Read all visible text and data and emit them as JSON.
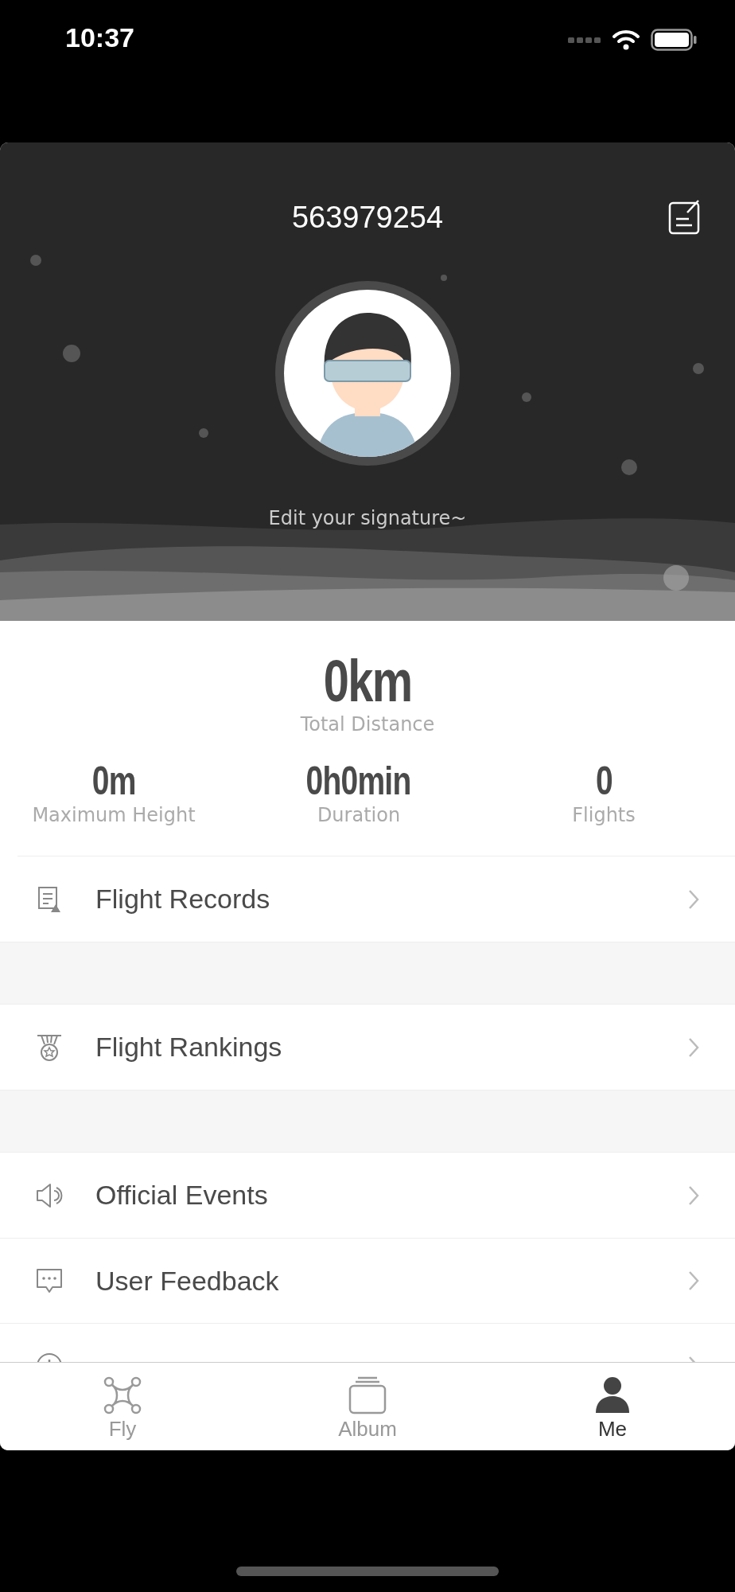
{
  "status_bar": {
    "time": "10:37"
  },
  "profile": {
    "username": "563979254",
    "signature": "Edit your signature~"
  },
  "stats": {
    "total": {
      "value": "0km",
      "label": "Total Distance"
    },
    "items": [
      {
        "value": "0m",
        "label": "Maximum Height"
      },
      {
        "value": "0h0min",
        "label": "Duration"
      },
      {
        "value": "0",
        "label": "Flights"
      }
    ]
  },
  "menu_groups": [
    [
      {
        "label": "Flight Records",
        "kind": "records"
      }
    ],
    [
      {
        "label": "Flight Rankings",
        "kind": "rankings"
      }
    ],
    [
      {
        "label": "Official Events",
        "kind": "events"
      },
      {
        "label": "User Feedback",
        "kind": "feedback"
      },
      {
        "kind": "about"
      }
    ]
  ],
  "tab_bar": [
    {
      "label": "Fly",
      "kind": "fly",
      "selected": false
    },
    {
      "label": "Album",
      "kind": "album",
      "selected": false
    },
    {
      "label": "Me",
      "kind": "me",
      "selected": true
    }
  ]
}
